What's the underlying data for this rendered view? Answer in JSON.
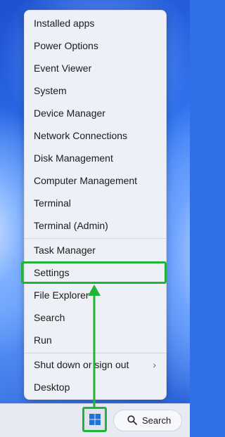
{
  "menu": {
    "items": [
      {
        "label": "Installed apps"
      },
      {
        "label": "Power Options"
      },
      {
        "label": "Event Viewer"
      },
      {
        "label": "System"
      },
      {
        "label": "Device Manager"
      },
      {
        "label": "Network Connections"
      },
      {
        "label": "Disk Management"
      },
      {
        "label": "Computer Management"
      },
      {
        "label": "Terminal"
      },
      {
        "label": "Terminal (Admin)"
      },
      {
        "label": "Task Manager"
      },
      {
        "label": "Settings"
      },
      {
        "label": "File Explorer"
      },
      {
        "label": "Search"
      },
      {
        "label": "Run"
      },
      {
        "label": "Shut down or sign out"
      },
      {
        "label": "Desktop"
      }
    ],
    "chevron_icon": "chevron-right-icon"
  },
  "taskbar": {
    "start_icon": "windows-logo-icon",
    "search_label": "Search",
    "search_icon": "search-icon"
  },
  "colors": {
    "highlight": "#22b33a",
    "menu_bg": "#eef0f7",
    "windows_logo": "#1f6fd9"
  }
}
